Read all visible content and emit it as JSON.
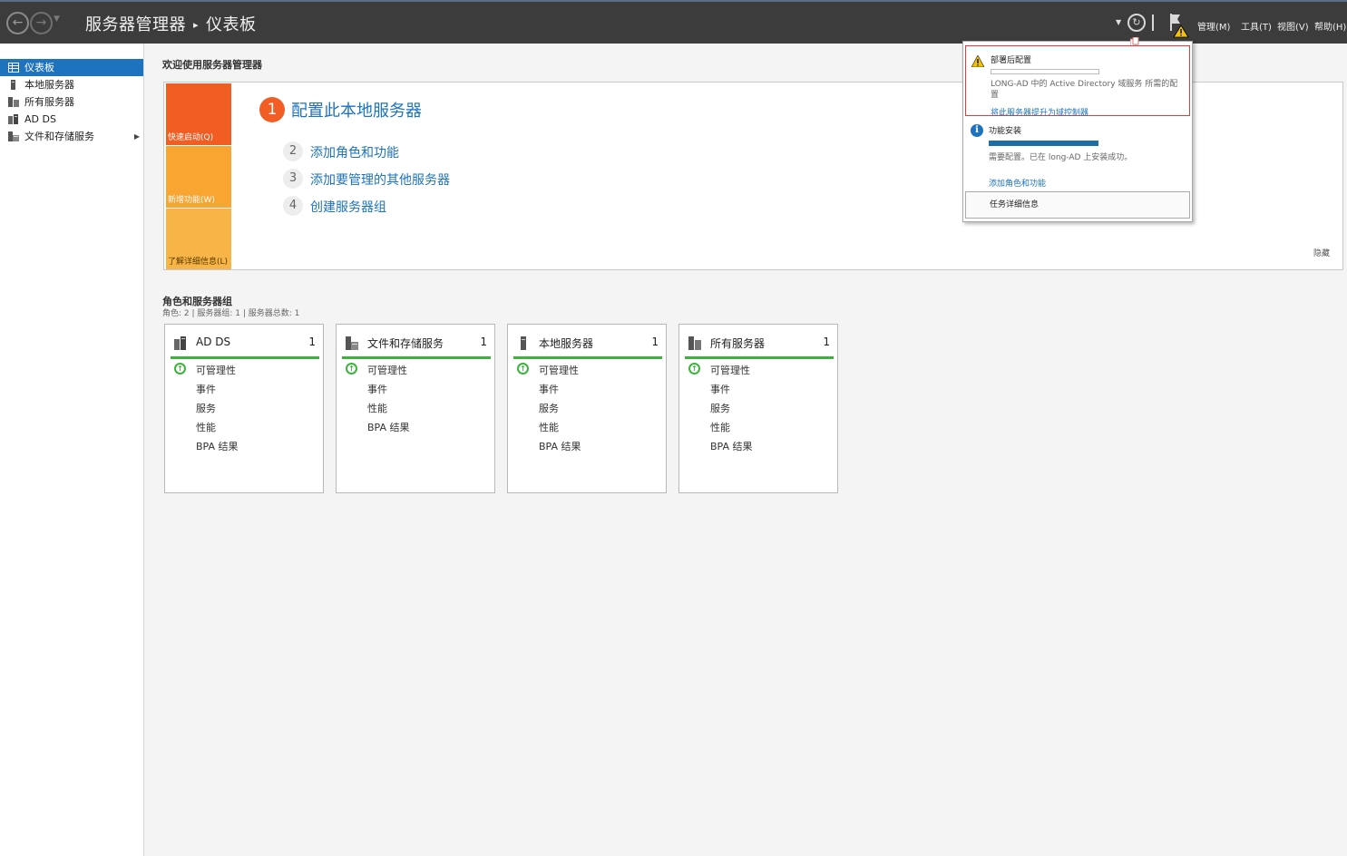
{
  "titlebar": {
    "app": "服务器管理器",
    "page": "仪表板",
    "menus": [
      "管理(M)",
      "工具(T)",
      "视图(V)",
      "帮助(H)"
    ]
  },
  "sidebar": {
    "items": [
      {
        "label": "仪表板",
        "active": true
      },
      {
        "label": "本地服务器"
      },
      {
        "label": "所有服务器"
      },
      {
        "label": "AD DS"
      },
      {
        "label": "文件和存储服务"
      }
    ]
  },
  "welcome": {
    "title": "欢迎使用服务器管理器",
    "tiles": [
      "快速启动(Q)",
      "新增功能(W)",
      "了解详细信息(L)"
    ],
    "main_step": {
      "num": "1",
      "label": "配置此本地服务器"
    },
    "steps": [
      {
        "num": "2",
        "label": "添加角色和功能"
      },
      {
        "num": "3",
        "label": "添加要管理的其他服务器"
      },
      {
        "num": "4",
        "label": "创建服务器组"
      }
    ],
    "hide": "隐藏"
  },
  "roles": {
    "title": "角色和服务器组",
    "subtitle": "角色: 2 | 服务器组: 1 | 服务器总数: 1",
    "cards": [
      {
        "title": "AD DS",
        "count": "1",
        "rows": [
          "可管理性",
          "事件",
          "服务",
          "性能",
          "BPA 结果"
        ]
      },
      {
        "title": "文件和存储服务",
        "count": "1",
        "rows": [
          "可管理性",
          "事件",
          "性能",
          "BPA 结果"
        ]
      },
      {
        "title": "本地服务器",
        "count": "1",
        "rows": [
          "可管理性",
          "事件",
          "服务",
          "性能",
          "BPA 结果"
        ]
      },
      {
        "title": "所有服务器",
        "count": "1",
        "rows": [
          "可管理性",
          "事件",
          "服务",
          "性能",
          "BPA 结果"
        ]
      }
    ]
  },
  "notifications": {
    "warning": {
      "title": "部署后配置",
      "message": "LONG-AD 中的 Active Directory 域服务 所需的配置",
      "link": "将此服务器提升为域控制器"
    },
    "info": {
      "title": "功能安装",
      "progress": 1.0,
      "message": "需要配置。已在 long-AD 上安装成功。",
      "link": "添加角色和功能"
    },
    "task_details": "任务详细信息"
  },
  "colors": {
    "titlebar": "#3c3c3c",
    "accent": "#1e73be",
    "orange": "#f15d22",
    "status_ok": "#3db33d",
    "alert_border": "#e03c3c"
  }
}
